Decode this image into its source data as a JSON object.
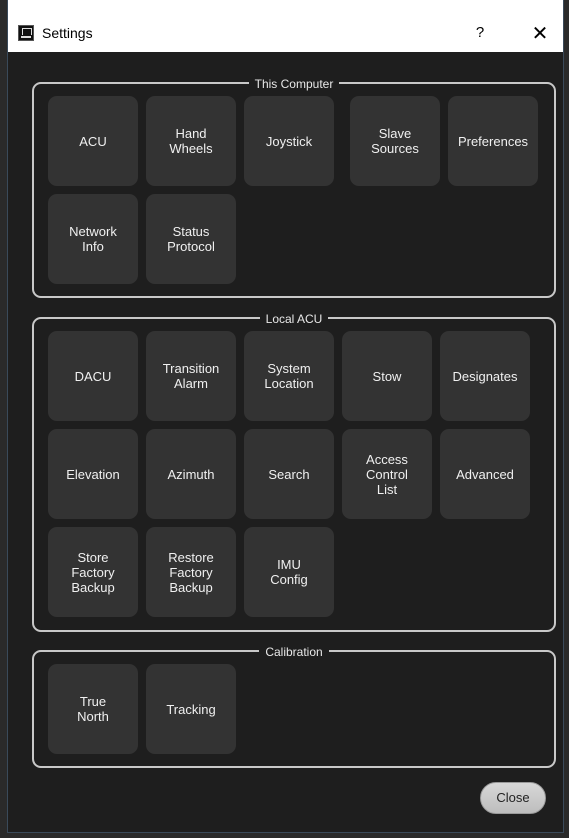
{
  "window": {
    "title": "Settings",
    "help_label": "?",
    "close_label": "✕"
  },
  "groups": {
    "this_computer": {
      "title": "This Computer",
      "tiles": [
        "ACU",
        "Hand\nWheels",
        "Joystick",
        "Slave\nSources",
        "Preferences",
        "Network\nInfo",
        "Status\nProtocol"
      ]
    },
    "local_acu": {
      "title": "Local ACU",
      "tiles": [
        "DACU",
        "Transition\nAlarm",
        "System\nLocation",
        "Stow",
        "Designates",
        "Elevation",
        "Azimuth",
        "Search",
        "Access\nControl\nList",
        "Advanced",
        "Store\nFactory\nBackup",
        "Restore\nFactory\nBackup",
        "IMU\nConfig"
      ]
    },
    "calibration": {
      "title": "Calibration",
      "tiles": [
        "True\nNorth",
        "Tracking"
      ]
    }
  },
  "footer": {
    "close_label": "Close"
  },
  "colors": {
    "window_bg": "#1e1e1e",
    "tile_bg": "#333333",
    "group_border": "#c8c8c8",
    "text": "#f0f0f0"
  }
}
